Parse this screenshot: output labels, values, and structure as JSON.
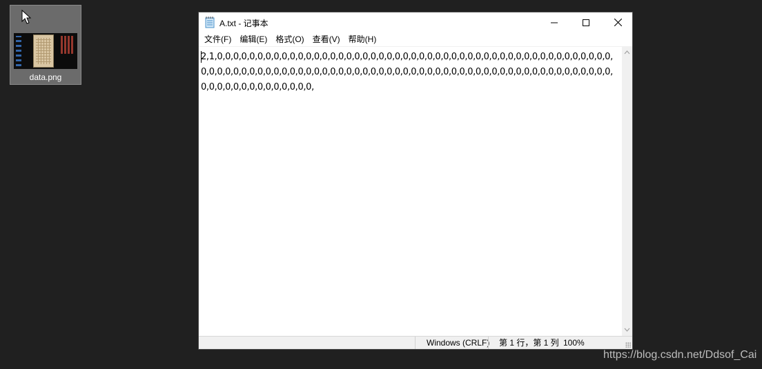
{
  "desktop": {
    "icon_label": "data.png"
  },
  "window": {
    "title": "A.txt - 记事本",
    "menu": [
      {
        "label": "文件(F)"
      },
      {
        "label": "编辑(E)"
      },
      {
        "label": "格式(O)"
      },
      {
        "label": "查看(V)"
      },
      {
        "label": "帮助(H)"
      }
    ],
    "content": "2,1,0,0,0,0,0,0,0,0,0,0,0,0,0,0,0,0,0,0,0,0,0,0,0,0,0,0,0,0,0,0,0,0,0,0,0,0,0,0,0,0,0,0,0,0,0,0,0,0,0,0,0,0,0,0,0,0,0,0,0,0,0,0,0,0,0,0,0,0,0,0,0,0,0,0,0,0,0,0,0,0,0,0,0,0,0,0,0,0,0,0,0,0,0,0,0,0,0,0,0,0,0,0,0,0,0,0,0,0,0,0,0,0,0,0,",
    "status": {
      "encoding": "Windows (CRLF)",
      "position": "第 1 行，第 1 列",
      "zoom": "100%"
    }
  },
  "watermark": "https://blog.csdn.net/Ddsof_Cai"
}
